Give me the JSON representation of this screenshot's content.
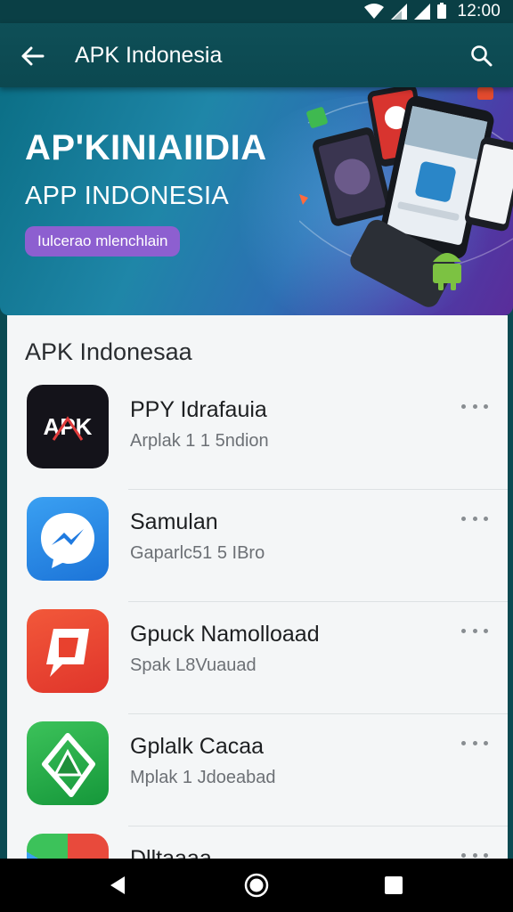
{
  "status_bar": {
    "time": "12:00"
  },
  "app_bar": {
    "title": "APK Indonesia"
  },
  "banner": {
    "headline": "AP'KINIAIIDIA",
    "subline": "APP INDONESIA",
    "pill_label": "Iulcerao mlenchlain"
  },
  "section": {
    "title": "APK Indonesaa"
  },
  "apps": [
    {
      "icon": "apk-app-icon",
      "icon_text": "APK",
      "title": "PPY Idrafauia",
      "subtitle": "Arplak 1 1 5ndion"
    },
    {
      "icon": "messenger-app-icon",
      "title": "Samulan",
      "subtitle": "Gaparlc51 5 IBro"
    },
    {
      "icon": "chat-bubble-app-icon",
      "title": "Gpuck Namolloaad",
      "subtitle": "Spak L8Vuauad"
    },
    {
      "icon": "triangle-app-icon",
      "title": "Gplalk Cacaa",
      "subtitle": "Mplak 1 Jdoeabad"
    },
    {
      "icon": "partial-app-icon",
      "title": "Dlltaaaa",
      "subtitle": ""
    }
  ],
  "colors": {
    "status_bar": "#0a3f45",
    "app_bar": "#0e4f57",
    "banner_pill": "#8d5fd0",
    "card_background": "#f4f6f7"
  }
}
